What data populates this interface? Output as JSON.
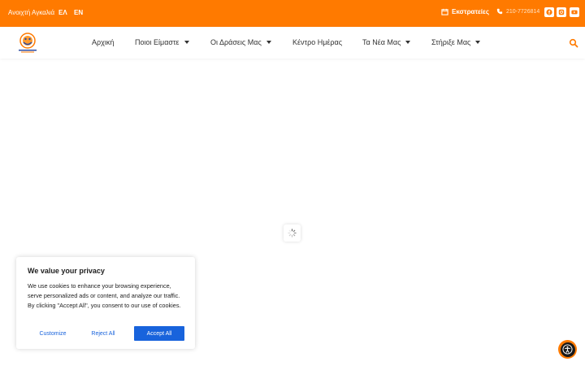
{
  "topbar": {
    "brand": "Ανοιχτή Αγκαλιά",
    "lang_el": "ΕΛ",
    "lang_en": "EN",
    "trips_label": "Εκστρατείες",
    "phone": "210-7726814",
    "social_icons": [
      "facebook-icon",
      "instagram-icon",
      "youtube-icon"
    ]
  },
  "nav": {
    "items": [
      {
        "label": "Αρχική",
        "has_dropdown": false
      },
      {
        "label": "Ποιοι Είμαστε",
        "has_dropdown": true
      },
      {
        "label": "Οι Δράσεις Μας",
        "has_dropdown": true
      },
      {
        "label": "Κέντρο Ημέρας",
        "has_dropdown": false
      },
      {
        "label": "Τα Νέα Μας",
        "has_dropdown": true
      },
      {
        "label": "Στήριξε Μας",
        "has_dropdown": true
      }
    ]
  },
  "cookie": {
    "title": "We value your privacy",
    "text": "We use cookies to enhance your browsing experience, serve personalized ads or content, and analyze our traffic. By clicking \"Accept All\", you consent to our use of cookies.",
    "customize": "Customize",
    "reject": "Reject All",
    "accept": "Accept All"
  },
  "colors": {
    "brand_orange": "#ff7a00",
    "button_blue": "#1863dc"
  }
}
